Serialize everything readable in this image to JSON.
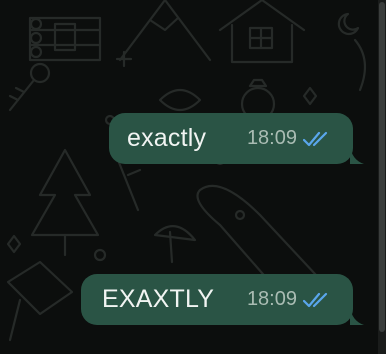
{
  "chat": {
    "messages": [
      {
        "text": "exactly",
        "time": "18:09",
        "status": "read"
      },
      {
        "text": "EXAXTLY",
        "time": "18:09",
        "status": "read"
      }
    ]
  },
  "colors": {
    "background": "#0c0e0d",
    "outgoing_bubble": "#2a5445",
    "read_ticks": "#5aa6ec",
    "time_text": "#a9bcb3",
    "doodle_lines": "#262a28"
  }
}
